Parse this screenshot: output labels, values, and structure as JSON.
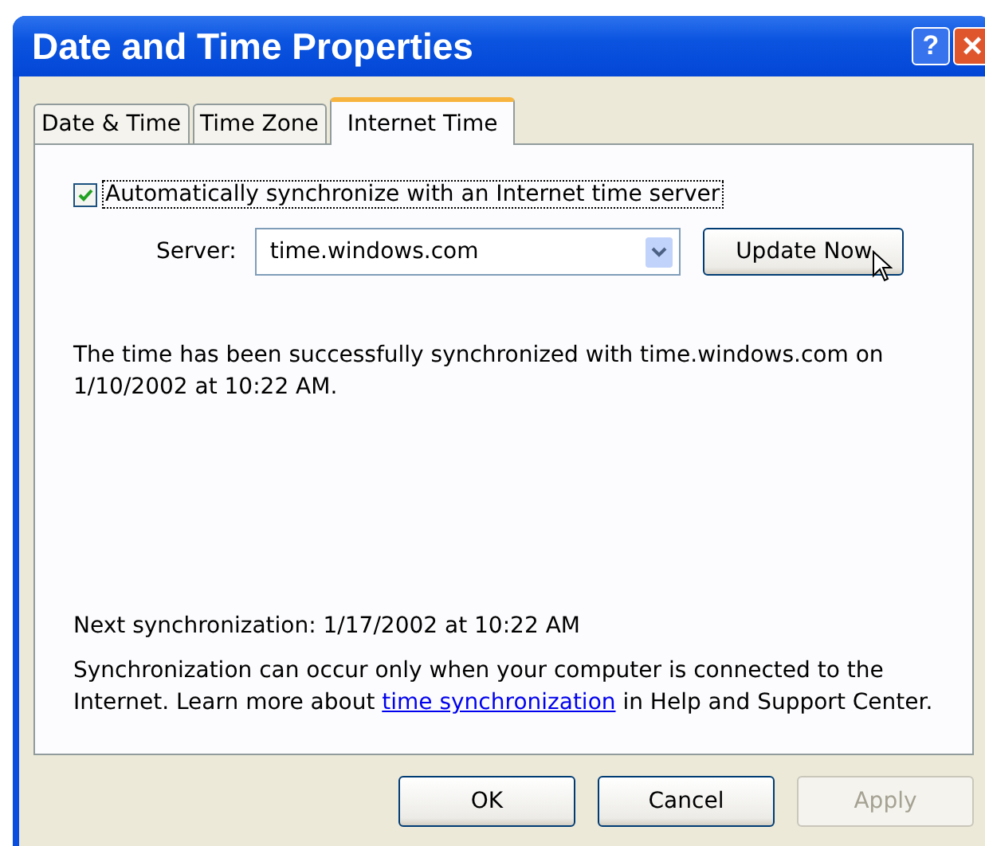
{
  "window": {
    "title": "Date and Time Properties",
    "buttons": [
      "?",
      "×"
    ]
  },
  "tabs": [
    {
      "label": "Date & Time",
      "selected": false
    },
    {
      "label": "Time Zone",
      "selected": false
    },
    {
      "label": "Internet Time",
      "selected": true
    }
  ],
  "auto_sync": {
    "label": "Automatically synchronize with an Internet time server",
    "checked": true
  },
  "server": {
    "label": "Server:",
    "value": "time.windows.com"
  },
  "update_button": {
    "label": "Update Now"
  },
  "status": "The time has been successfully synchronized with time.windows.com on 1/10/2002 at 10:22 AM.",
  "next_sync": "Next synchronization: 1/17/2002 at 10:22 AM",
  "info": {
    "before": "Synchronization can occur only when your computer is connected to the Internet.  Learn more about",
    "link": "time synchronization",
    "after": "in Help and Support Center."
  },
  "buttons": [
    {
      "label": "OK",
      "disabled": false
    },
    {
      "label": "Cancel",
      "disabled": false
    },
    {
      "label": "Apply",
      "disabled": true
    }
  ]
}
